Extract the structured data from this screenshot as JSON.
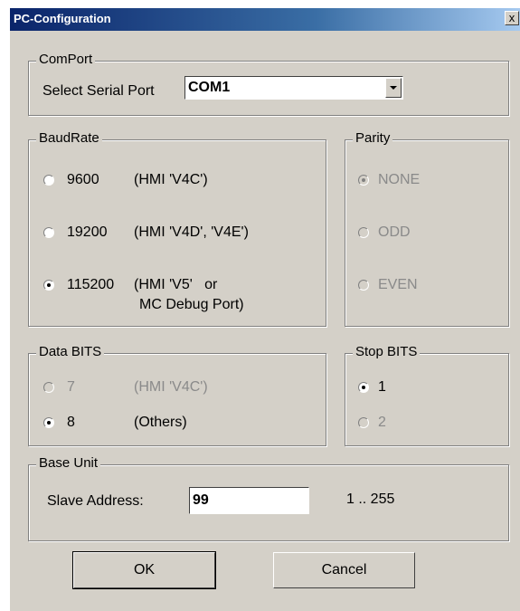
{
  "window": {
    "title": "PC-Configuration",
    "close_glyph": "x"
  },
  "comport": {
    "legend": "ComPort",
    "select_label": "Select Serial Port",
    "selected_value": "COM1"
  },
  "baudrate": {
    "legend": "BaudRate",
    "options": [
      {
        "value": "9600",
        "desc": "(HMI 'V4C')",
        "selected": false
      },
      {
        "value": "19200",
        "desc": "(HMI 'V4D', 'V4E')",
        "selected": false
      },
      {
        "value": "115200",
        "desc": "(HMI 'V5'   or",
        "desc2": "MC Debug Port)",
        "selected": true
      }
    ]
  },
  "parity": {
    "legend": "Parity",
    "options": [
      {
        "label": "NONE",
        "selected": true,
        "enabled": false
      },
      {
        "label": "ODD",
        "selected": false,
        "enabled": false
      },
      {
        "label": "EVEN",
        "selected": false,
        "enabled": false
      }
    ]
  },
  "databits": {
    "legend": "Data BITS",
    "options": [
      {
        "value": "7",
        "desc": "(HMI 'V4C')",
        "selected": false,
        "enabled": false
      },
      {
        "value": "8",
        "desc": "(Others)",
        "selected": true,
        "enabled": true
      }
    ]
  },
  "stopbits": {
    "legend": "Stop BITS",
    "options": [
      {
        "label": "1",
        "selected": true,
        "enabled": true
      },
      {
        "label": "2",
        "selected": false,
        "enabled": false
      }
    ]
  },
  "baseunit": {
    "legend": "Base Unit",
    "slave_label": "Slave Address:",
    "slave_value": "99",
    "range": "1 .. 255"
  },
  "buttons": {
    "ok": "OK",
    "cancel": "Cancel"
  },
  "colors": {
    "dialog_bg": "#d4d0c8",
    "title_start": "#0a246a",
    "title_end": "#a6caf0",
    "disabled_text": "#8a8a8a"
  },
  "icons": {
    "close": "close-icon",
    "dropdown": "chevron-down-icon"
  }
}
